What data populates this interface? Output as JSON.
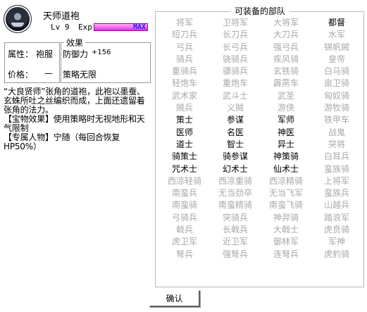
{
  "item": {
    "name": "天师道袍",
    "level": "Lv 9",
    "exp_label": "Exp",
    "exp_max_label": "MAX",
    "exp_progress": 1.0
  },
  "attributes": {
    "attr_label": "属性：",
    "attr_value": "袍服",
    "price_label": "价格：",
    "price_value": "—"
  },
  "effect": {
    "title": "效果",
    "line1_label": "防御力",
    "line1_value": "+156",
    "line2": "策略无限"
  },
  "description": [
    "“大良贤师”张角的道袍，此袍以墨蚕、玄蛛所吐之丝编织而成，上面还遗留着张角的法力。",
    "【宝物效果】使用策略时无视地形和天气限制",
    "【专属人物】宁随（每回合恢复HP50%）"
  ],
  "units_panel": {
    "title": "可装备的部队",
    "units": [
      {
        "name": "将军",
        "enabled": false
      },
      {
        "name": "卫将军",
        "enabled": false
      },
      {
        "name": "大将军",
        "enabled": false
      },
      {
        "name": "都督",
        "enabled": true
      },
      {
        "name": "短刀兵",
        "enabled": false
      },
      {
        "name": "长刀兵",
        "enabled": false
      },
      {
        "name": "大刀兵",
        "enabled": false
      },
      {
        "name": "水军",
        "enabled": false
      },
      {
        "name": "弓兵",
        "enabled": false
      },
      {
        "name": "长弓兵",
        "enabled": false
      },
      {
        "name": "强弓兵",
        "enabled": false
      },
      {
        "name": "锦帆贼",
        "enabled": false
      },
      {
        "name": "骑兵",
        "enabled": false
      },
      {
        "name": "骁骑兵",
        "enabled": false
      },
      {
        "name": "疾风骑",
        "enabled": false
      },
      {
        "name": "皇帝",
        "enabled": false
      },
      {
        "name": "重骑兵",
        "enabled": false
      },
      {
        "name": "骠骑兵",
        "enabled": false
      },
      {
        "name": "玄铁骑",
        "enabled": false
      },
      {
        "name": "白马骑",
        "enabled": false
      },
      {
        "name": "轻炮车",
        "enabled": false
      },
      {
        "name": "重炮车",
        "enabled": false
      },
      {
        "name": "霹雳车",
        "enabled": false
      },
      {
        "name": "亩卫骑",
        "enabled": false
      },
      {
        "name": "武术家",
        "enabled": false
      },
      {
        "name": "武斗士",
        "enabled": false
      },
      {
        "name": "武圣",
        "enabled": false
      },
      {
        "name": "匈奴骑",
        "enabled": false
      },
      {
        "name": "贼兵",
        "enabled": false
      },
      {
        "name": "义贼",
        "enabled": false
      },
      {
        "name": "游侠",
        "enabled": false
      },
      {
        "name": "游牧骑",
        "enabled": false
      },
      {
        "name": "策士",
        "enabled": true
      },
      {
        "name": "参谋",
        "enabled": true
      },
      {
        "name": "军师",
        "enabled": true
      },
      {
        "name": "铁甲车",
        "enabled": false
      },
      {
        "name": "医师",
        "enabled": true
      },
      {
        "name": "名医",
        "enabled": true
      },
      {
        "name": "神医",
        "enabled": true
      },
      {
        "name": "战鬼",
        "enabled": false
      },
      {
        "name": "道士",
        "enabled": true
      },
      {
        "name": "智士",
        "enabled": true
      },
      {
        "name": "异士",
        "enabled": true
      },
      {
        "name": "突将",
        "enabled": false
      },
      {
        "name": "骑策士",
        "enabled": true
      },
      {
        "name": "骑参谋",
        "enabled": true
      },
      {
        "name": "神策骑",
        "enabled": true
      },
      {
        "name": "白耳兵",
        "enabled": false
      },
      {
        "name": "咒术士",
        "enabled": true
      },
      {
        "name": "幻术士",
        "enabled": true
      },
      {
        "name": "仙术士",
        "enabled": true
      },
      {
        "name": "蛮族骑",
        "enabled": false
      },
      {
        "name": "西凉轻骑",
        "enabled": false
      },
      {
        "name": "西凉重骑",
        "enabled": false
      },
      {
        "name": "西凉精骑",
        "enabled": false
      },
      {
        "name": "上将军",
        "enabled": false
      },
      {
        "name": "南蛮兵",
        "enabled": false
      },
      {
        "name": "无当劲卒",
        "enabled": false
      },
      {
        "name": "无当飞军",
        "enabled": false
      },
      {
        "name": "蛮族兵",
        "enabled": false
      },
      {
        "name": "南蛮骑",
        "enabled": false
      },
      {
        "name": "南蛮精骑",
        "enabled": false
      },
      {
        "name": "南蛮飞骑",
        "enabled": false
      },
      {
        "name": "山越兵",
        "enabled": false
      },
      {
        "name": "弓骑兵",
        "enabled": false
      },
      {
        "name": "突骑兵",
        "enabled": false
      },
      {
        "name": "神羿骑",
        "enabled": false
      },
      {
        "name": "踏浪军",
        "enabled": false
      },
      {
        "name": "戟兵",
        "enabled": false
      },
      {
        "name": "长戟兵",
        "enabled": false
      },
      {
        "name": "大戟士",
        "enabled": false
      },
      {
        "name": "虎贲骑",
        "enabled": false
      },
      {
        "name": "虎卫军",
        "enabled": false
      },
      {
        "name": "近卫军",
        "enabled": false
      },
      {
        "name": "御林军",
        "enabled": false
      },
      {
        "name": "军神",
        "enabled": false
      },
      {
        "name": "弩兵",
        "enabled": false
      },
      {
        "name": "强弩兵",
        "enabled": false
      },
      {
        "name": "连弩兵",
        "enabled": false
      },
      {
        "name": "虎豹骑",
        "enabled": false
      }
    ]
  },
  "buttons": {
    "confirm": "确认"
  },
  "colors": {
    "enabled_text": "#000000",
    "disabled_text": "#a8a8a8",
    "exp_bar": "#e030e0",
    "exp_max_text": "#2020ff"
  }
}
